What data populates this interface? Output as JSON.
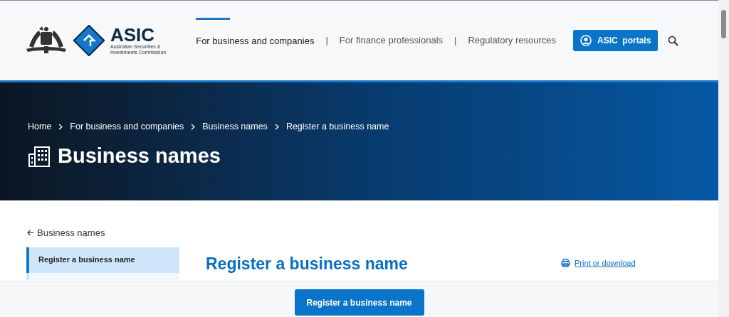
{
  "header": {
    "logo": {
      "name": "ASIC",
      "subtitle_lines": [
        "Australian Securities &",
        "Investments Commission"
      ]
    },
    "nav": [
      {
        "label": "For business and companies",
        "selected": true
      },
      {
        "label": "For finance professionals",
        "selected": false
      },
      {
        "label": "Regulatory resources",
        "selected": false
      }
    ],
    "nav_separators": [
      "|",
      "|"
    ],
    "portals_button": "ASIC  portals"
  },
  "hero": {
    "breadcrumbs": [
      "Home",
      "For business and companies",
      "Business names",
      "Register a business name"
    ],
    "title": "Business names"
  },
  "sidebar": {
    "back_link": "Business names",
    "items": [
      {
        "label": "Register a business name",
        "selected": true
      }
    ]
  },
  "main": {
    "heading": "Register a business name",
    "print_link": "Print or download"
  },
  "sticky_bar": {
    "button": "Register a business name"
  }
}
